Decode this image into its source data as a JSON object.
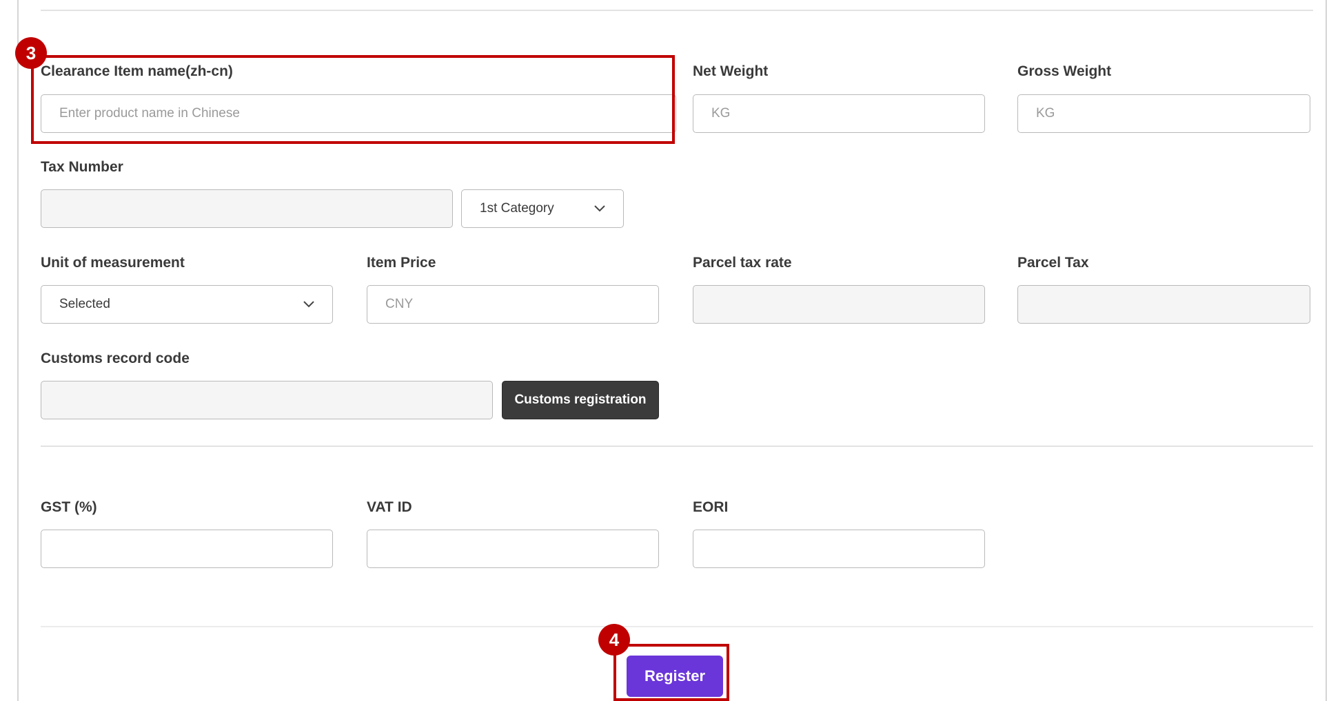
{
  "form": {
    "clearance_item_name": {
      "label": "Clearance Item name(zh-cn)",
      "placeholder": "Enter product name in Chinese"
    },
    "net_weight": {
      "label": "Net Weight",
      "placeholder": "KG"
    },
    "gross_weight": {
      "label": "Gross Weight",
      "placeholder": "KG"
    },
    "tax_number": {
      "label": "Tax Number",
      "category_value": "1st Category"
    },
    "unit_of_measurement": {
      "label": "Unit of measurement",
      "value": "Selected"
    },
    "item_price": {
      "label": "Item Price",
      "placeholder": "CNY"
    },
    "parcel_tax_rate": {
      "label": "Parcel tax rate"
    },
    "parcel_tax": {
      "label": "Parcel Tax"
    },
    "customs_record_code": {
      "label": "Customs record code",
      "button_label": "Customs registration"
    },
    "gst": {
      "label": "GST (%)"
    },
    "vat_id": {
      "label": "VAT ID"
    },
    "eori": {
      "label": "EORI"
    },
    "register_label": "Register"
  },
  "markers": {
    "step3": "3",
    "step4": "4"
  },
  "colors": {
    "accent": "#6a35d9",
    "highlight": "#c00000",
    "dark_button": "#3b3b3b"
  },
  "icons": {
    "dropdown": "chevron-down-icon"
  }
}
